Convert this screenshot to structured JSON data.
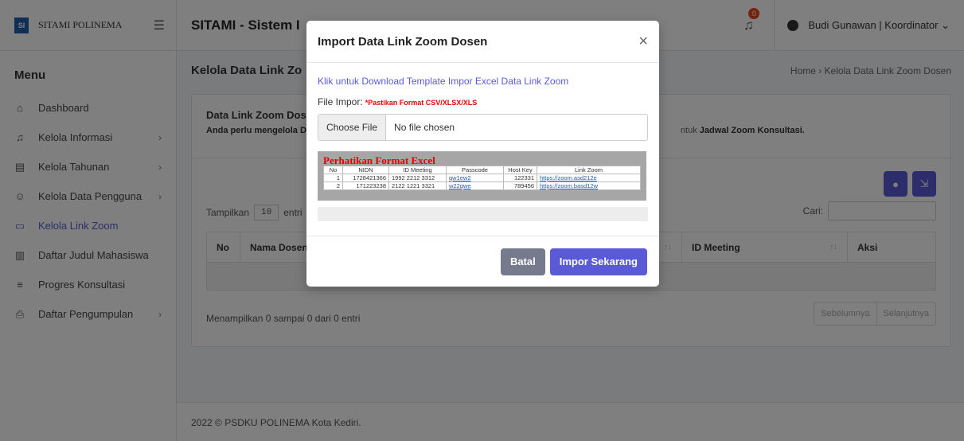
{
  "sidebar": {
    "brand": "SITAMI POLINEMA",
    "logo_text": "SI",
    "menu_title": "Menu",
    "items": [
      {
        "label": "Dashboard",
        "icon": "⌂",
        "chevron": ""
      },
      {
        "label": "Kelola Informasi",
        "icon": "🔔",
        "chevron": "›"
      },
      {
        "label": "Kelola Tahunan",
        "icon": "▤",
        "chevron": "›"
      },
      {
        "label": "Kelola Data Pengguna",
        "icon": "👥",
        "chevron": "›"
      },
      {
        "label": "Kelola Link Zoom",
        "icon": "▭",
        "chevron": ""
      },
      {
        "label": "Daftar Judul Mahasiswa",
        "icon": "📖",
        "chevron": ""
      },
      {
        "label": "Progres Konsultasi",
        "icon": "≡",
        "chevron": ""
      },
      {
        "label": "Daftar Pengumpulan",
        "icon": "⎙",
        "chevron": "›"
      }
    ]
  },
  "topbar": {
    "title": "SITAMI - Sistem I",
    "notification_count": "0",
    "user": "Budi Gunawan | Koordinator ⌄"
  },
  "page": {
    "title": "Kelola Data Link Zo",
    "breadcrumb": "Home  ›  Kelola Data Link Zoom Dosen"
  },
  "card": {
    "title": "Data Link Zoom Dos",
    "desc_prefix": "Anda perlu mengelola D",
    "desc_suffix_pre": "ntuk ",
    "desc_suffix_bold": "Jadwal Zoom Konsultasi.",
    "length_prefix": "Tampilkan",
    "length_value": "10",
    "length_suffix": "entri",
    "search_label": "Cari:",
    "columns": [
      "No",
      "Nama Dosen",
      "",
      "ID Meeting",
      "Aksi"
    ],
    "sort_icon": "↑↓",
    "empty_text": "i",
    "info": "Menampilkan 0 sampai 0 dari 0 entri",
    "prev": "Sebelumnya",
    "next": "Selanjutnya"
  },
  "footer": "2022 © PSDKU POLINEMA Kota Kediri.",
  "modal": {
    "title": "Import Data Link Zoom Dosen",
    "close": "×",
    "download_link": "Klik untuk Download Template Impor Excel Data Link Zoom",
    "file_label": "File Impor:",
    "file_note": "*Pastikan Format CSV/XLSX/XLS",
    "choose_file": "Choose File",
    "no_file": "No file chosen",
    "format_title": "Perhatikan Format Excel",
    "format_headers": [
      "No",
      "NIDN",
      "ID Meeting",
      "Passcode",
      "Host Key",
      "Link Zoom"
    ],
    "format_rows": [
      [
        "1",
        "1728421366",
        "1992 2212 3312",
        "qw1ew2",
        "122331",
        "https://zoom.asd212e"
      ],
      [
        "2",
        "171223238",
        "2122 1221 3321",
        "w22qwe",
        "789456",
        "https://zoom.basd12w"
      ]
    ],
    "cancel": "Batal",
    "import": "Impor Sekarang"
  }
}
